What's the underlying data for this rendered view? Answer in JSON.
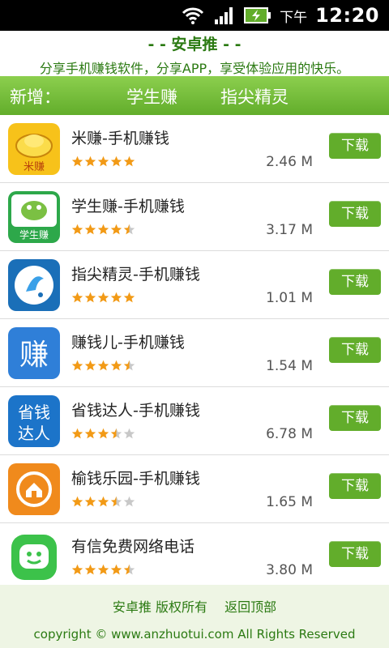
{
  "status_bar": {
    "time_label": "下午",
    "time": "12:20"
  },
  "header": {
    "title": "- - 安卓推 - -",
    "slogan": "分享手机赚钱软件，分享APP，享受体验应用的快乐。"
  },
  "new_bar": {
    "label": "新增：",
    "links": [
      "学生赚",
      "指尖精灵"
    ]
  },
  "apps": [
    {
      "name": "米赚-手机赚钱",
      "size": "2.46 M",
      "rating": 5,
      "download": "下载",
      "icon": "mizhuan-icon"
    },
    {
      "name": "学生赚-手机赚钱",
      "size": "3.17 M",
      "rating": 4.5,
      "download": "下载",
      "icon": "xueshengzhuan-icon"
    },
    {
      "name": "指尖精灵-手机赚钱",
      "size": "1.01 M",
      "rating": 5,
      "download": "下载",
      "icon": "zhijianjingling-icon"
    },
    {
      "name": "赚钱儿-手机赚钱",
      "size": "1.54 M",
      "rating": 4.5,
      "download": "下载",
      "icon": "zhuanqianer-icon"
    },
    {
      "name": "省钱达人-手机赚钱",
      "size": "6.78 M",
      "rating": 3.5,
      "download": "下载",
      "icon": "shengqiandaren-icon"
    },
    {
      "name": "榆钱乐园-手机赚钱",
      "size": "1.65 M",
      "rating": 3.5,
      "download": "下载",
      "icon": "yuqianleyuan-icon"
    },
    {
      "name": "有信免费网络电话",
      "size": "3.80 M",
      "rating": 4.5,
      "download": "下载",
      "icon": "youxin-icon"
    }
  ],
  "footer": {
    "site_name": "安卓推 版权所有",
    "back_to_top": "返回顶部",
    "copyright": "copyright © www.anzhuotui.com All Rights Reserved"
  },
  "colors": {
    "accent": "#62ad2b",
    "text_green": "#2b7a12",
    "star": "#f29a16"
  }
}
